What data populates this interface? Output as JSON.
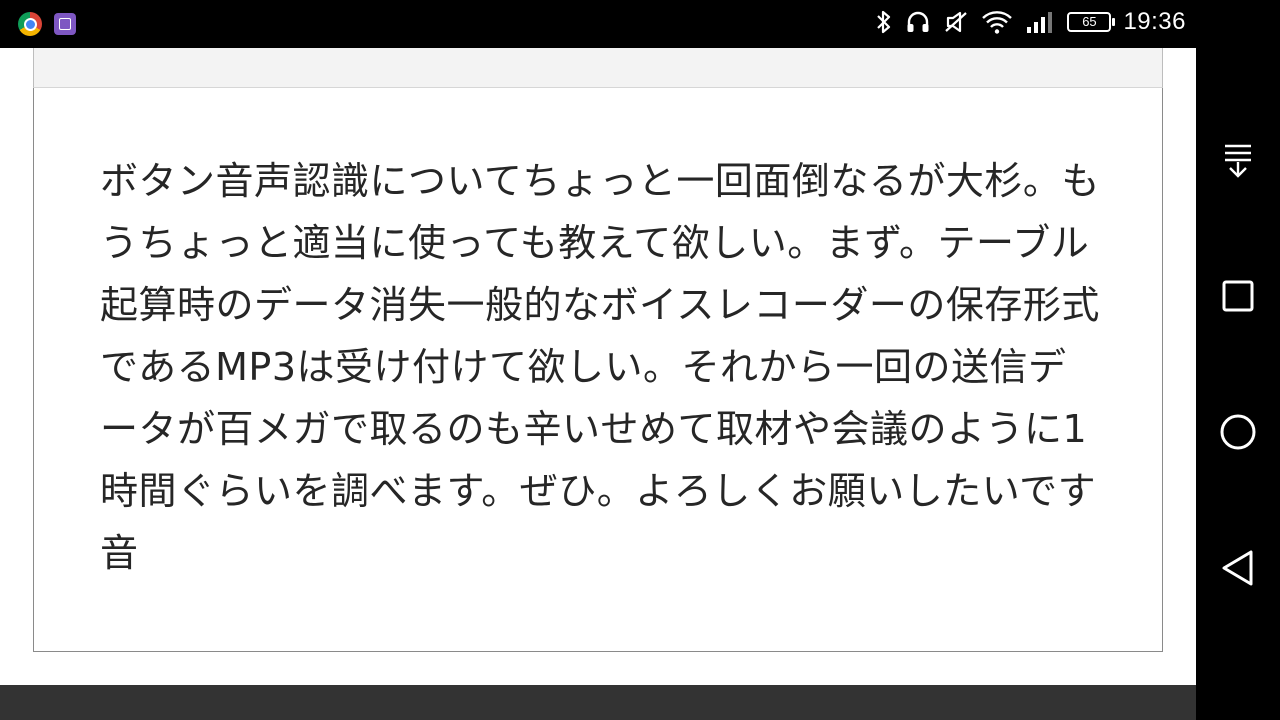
{
  "status_bar": {
    "time": "19:36",
    "battery_level": "65",
    "notification_icons": [
      "chrome-icon",
      "gallery-icon"
    ],
    "system_icons": [
      "bluetooth-icon",
      "headphones-icon",
      "mute-icon",
      "wifi-icon",
      "cellular-signal-icon",
      "battery-icon"
    ]
  },
  "message": {
    "text": "ボタン音声認識についてちょっと一回面倒なるが大杉。もうちょっと適当に使っても教えて欲しい。まず。テーブル起算時のデータ消失一般的なボイスレコーダーの保存形式であるMP3は受け付けて欲しい。それから一回の送信データが百メガで取るのも辛いせめて取材や会議のように1時間ぐらいを調べます。ぜひ。よろしくお願いしたいです音"
  },
  "navigation": {
    "buttons": [
      "notification-pull-icon",
      "recent-apps-icon",
      "home-icon",
      "back-icon"
    ]
  },
  "colors": {
    "text": "#262626",
    "card_border": "#8a8a8a",
    "header_strip": "#f3f3f3",
    "bottom_bar": "#333333",
    "system_bar": "#000000"
  }
}
